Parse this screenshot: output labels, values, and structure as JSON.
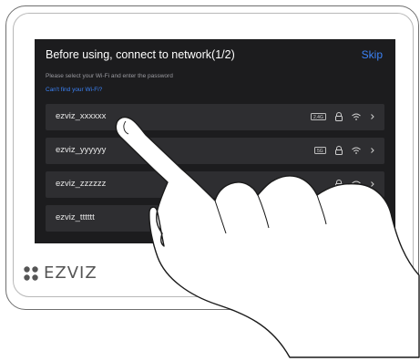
{
  "screen": {
    "title": "Before using, connect to network(1/2)",
    "skip_label": "Skip",
    "subtitle": "Please select your Wi-Fi and enter the password",
    "help_link": "Can't find your Wi-Fi?"
  },
  "networks": [
    {
      "name": "ezviz_xxxxxx",
      "band": "2.4G"
    },
    {
      "name": "ezviz_yyyyyy",
      "band": "5G"
    },
    {
      "name": "ezviz_zzzzzz",
      "band": ""
    },
    {
      "name": "ezviz_tttttt",
      "band": ""
    }
  ],
  "brand": {
    "name": "EZVIZ"
  },
  "colors": {
    "screen_bg": "#1c1c1e",
    "row_bg": "#2e2e31",
    "accent": "#3b82f6"
  }
}
